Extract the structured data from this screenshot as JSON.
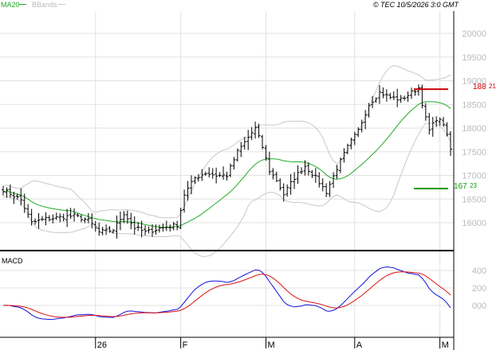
{
  "header": {
    "legend_ma": "MA20",
    "legend_bb": "BBands",
    "copyright": "© TEC 10/5/2026 3:0 GMT"
  },
  "colors": {
    "ma": "#22aa22",
    "bbands": "#c8c8c8",
    "price": "#000000",
    "grid": "#e2e2e2",
    "panel_border": "#000000",
    "resistance": "#cc0000",
    "support": "#119911",
    "macd": "#1111dd",
    "signal": "#dd1111",
    "tick_label": "#bbbbbb"
  },
  "chart_data": [
    {
      "type": "ohlc",
      "panel": "price",
      "y_ticks": [
        16000,
        16500,
        17000,
        17500,
        18000,
        18500,
        19000,
        19500,
        20000
      ],
      "y_tick_labels": [
        "16000",
        "16500",
        "17000",
        "17500",
        "18000",
        "18500",
        "19000",
        "19500",
        "20000"
      ],
      "ylim": [
        15900,
        20100
      ],
      "x_ticks": [
        {
          "label": "26",
          "index": 26
        },
        {
          "label": "F",
          "index": 50
        },
        {
          "label": "M",
          "index": 74
        },
        {
          "label": "A",
          "index": 99
        },
        {
          "label": "M",
          "index": 123
        }
      ],
      "grid": true,
      "legend_position": "top-left",
      "levels": [
        {
          "name": "resistance",
          "value": 18821,
          "label": "188 21",
          "label_main": "188",
          "label_sub": "21"
        },
        {
          "name": "support",
          "value": 16723,
          "label": "167 23",
          "label_main": "167",
          "label_sub": "23"
        }
      ],
      "keypoints": [
        [
          0,
          16700
        ],
        [
          5,
          16480
        ],
        [
          8,
          16000
        ],
        [
          12,
          16080
        ],
        [
          20,
          16150
        ],
        [
          24,
          16050
        ],
        [
          27,
          15800
        ],
        [
          31,
          15850
        ],
        [
          34,
          16200
        ],
        [
          37,
          15900
        ],
        [
          40,
          15800
        ],
        [
          45,
          15900
        ],
        [
          49,
          15950
        ],
        [
          51,
          16600
        ],
        [
          54,
          16950
        ],
        [
          57,
          17050
        ],
        [
          60,
          17000
        ],
        [
          63,
          17000
        ],
        [
          66,
          17500
        ],
        [
          68,
          17700
        ],
        [
          71,
          18000
        ],
        [
          73,
          17600
        ],
        [
          75,
          17100
        ],
        [
          77,
          16900
        ],
        [
          79,
          16600
        ],
        [
          82,
          16950
        ],
        [
          85,
          17200
        ],
        [
          88,
          16950
        ],
        [
          91,
          16650
        ],
        [
          94,
          17150
        ],
        [
          97,
          17600
        ],
        [
          100,
          17950
        ],
        [
          103,
          18500
        ],
        [
          106,
          18750
        ],
        [
          109,
          18650
        ],
        [
          112,
          18600
        ],
        [
          115,
          18750
        ],
        [
          117,
          18850
        ],
        [
          119,
          18200
        ],
        [
          120,
          17950
        ],
        [
          122,
          18200
        ],
        [
          124,
          18100
        ],
        [
          126,
          17550
        ]
      ],
      "bars_count": 127,
      "ma_period": 20,
      "bb_k": 2
    },
    {
      "type": "line",
      "panel": "macd",
      "title": "MACD",
      "y_ticks": [
        0,
        200,
        400
      ],
      "y_tick_labels": [
        "000",
        "200",
        "400"
      ],
      "series": [
        {
          "name": "MACD",
          "role": "macd"
        },
        {
          "name": "",
          "role": "signal"
        }
      ],
      "grid": true
    }
  ]
}
